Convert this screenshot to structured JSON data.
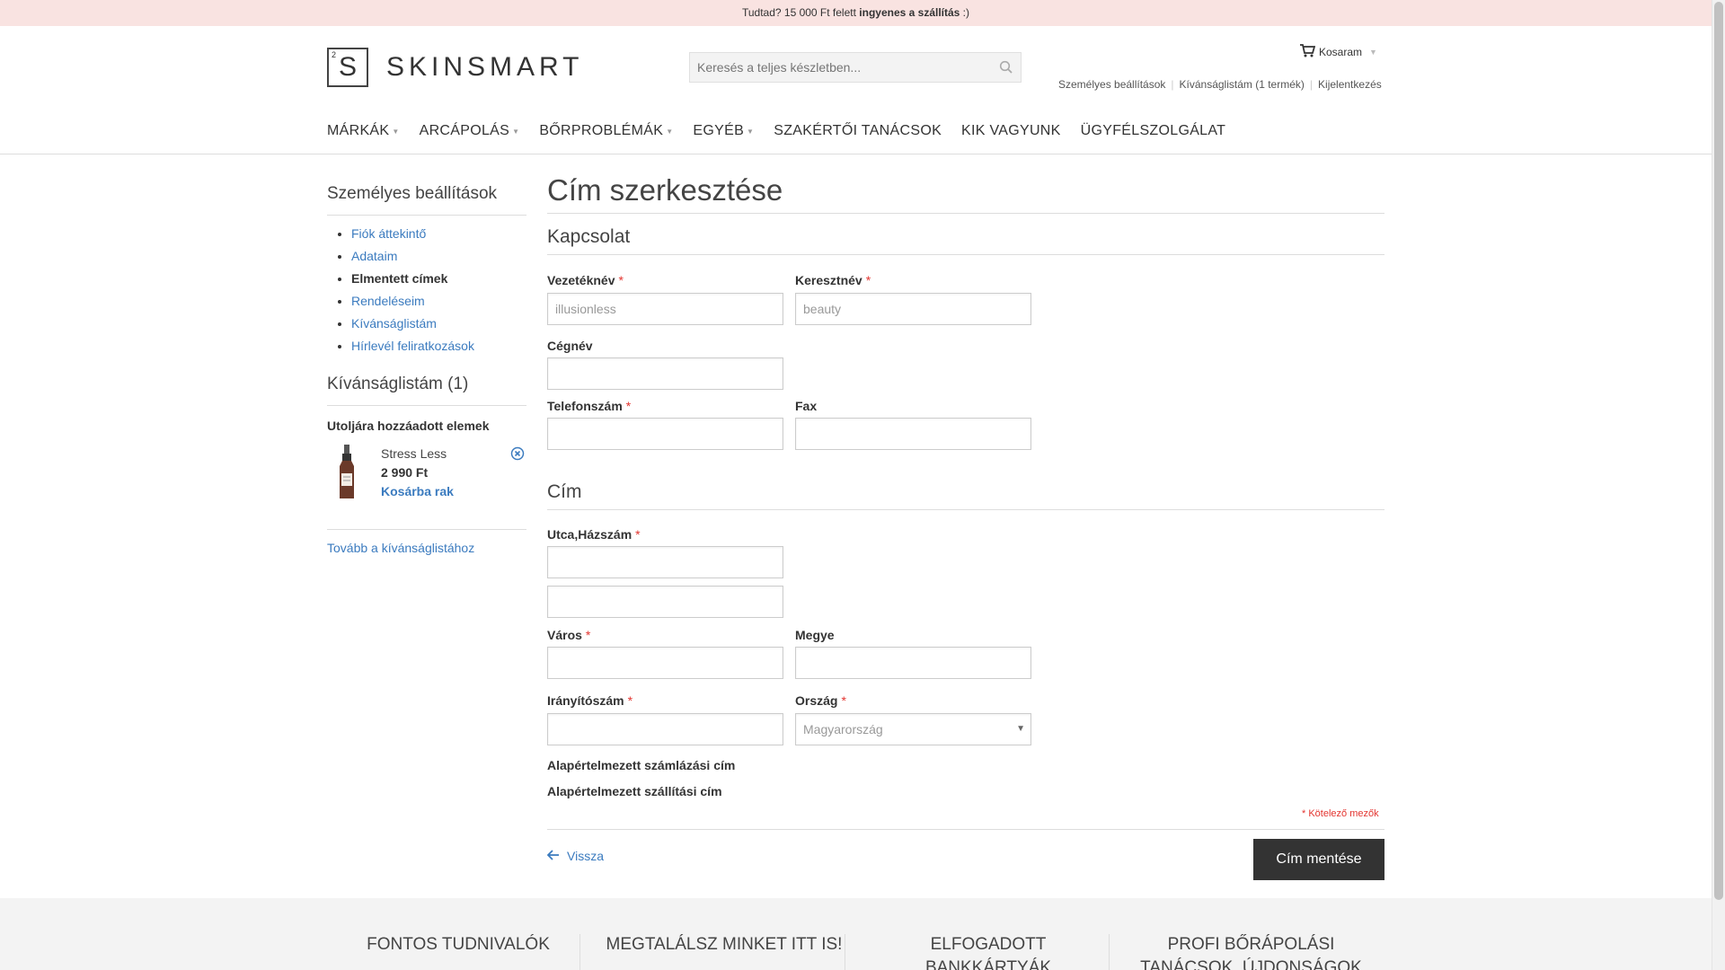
{
  "topbar": {
    "text_prefix": "Tudtad? 15 000 Ft felett ",
    "text_bold": "ingyenes a szállítás",
    "text_suffix": " :)"
  },
  "header": {
    "logo_superscript": "2",
    "logo_letter": "S",
    "logo_word": "SKINSMART",
    "search_placeholder": "Keresés a teljes készletben...",
    "cart_label": "Kosaram",
    "top_links": [
      "Személyes beállítások",
      "Kívánságlistám (1 termék)",
      "Kijelentkezés"
    ]
  },
  "nav": {
    "items": [
      {
        "label": "MÁRKÁK",
        "dropdown": true
      },
      {
        "label": "ARCÁPOLÁS",
        "dropdown": true
      },
      {
        "label": "BŐRPROBLÉMÁK",
        "dropdown": true
      },
      {
        "label": "EGYÉB",
        "dropdown": true
      },
      {
        "label": "SZAKÉRTŐI TANÁCSOK",
        "dropdown": false
      },
      {
        "label": "KIK VAGYUNK",
        "dropdown": false
      },
      {
        "label": "ÜGYFÉLSZOLGÁLAT",
        "dropdown": false
      }
    ]
  },
  "sidebar": {
    "title": "Személyes beállítások",
    "items": [
      {
        "label": "Fiók áttekintő",
        "active": false
      },
      {
        "label": "Adataim",
        "active": false
      },
      {
        "label": "Elmentett címek",
        "active": true
      },
      {
        "label": "Rendeléseim",
        "active": false
      },
      {
        "label": "Kívánságlistám",
        "active": false
      },
      {
        "label": "Hírlevél feliratkozások",
        "active": false
      }
    ],
    "wishlist_title": "Kívánságlistám (1)",
    "wishlist_subtitle": "Utoljára hozzáadott elemek",
    "wishlist_item": {
      "name": "Stress Less",
      "price": "2 990 Ft",
      "add_to_cart": "Kosárba rak"
    },
    "wishlist_more": "Tovább a kívánságlistához"
  },
  "form": {
    "page_title": "Cím szerkesztése",
    "contact_title": "Kapcsolat",
    "address_title": "Cím",
    "fields": {
      "lastname": {
        "label": "Vezetéknév",
        "value": "illusionless",
        "required": "*"
      },
      "firstname": {
        "label": "Keresztnév",
        "value": "beauty",
        "required": "*"
      },
      "company": {
        "label": "Cégnév",
        "value": ""
      },
      "phone": {
        "label": "Telefonszám",
        "value": "",
        "required": "*"
      },
      "fax": {
        "label": "Fax",
        "value": ""
      },
      "street": {
        "label": "Utca,Házszám",
        "value": "",
        "required": "*"
      },
      "street2": {
        "value": ""
      },
      "city": {
        "label": "Város",
        "value": "",
        "required": "*"
      },
      "region": {
        "label": "Megye",
        "value": ""
      },
      "zip": {
        "label": "Irányítószám",
        "value": "",
        "required": "*"
      },
      "country": {
        "label": "Ország",
        "value": "Magyarország",
        "required": "*"
      }
    },
    "default_billing": "Alapértelmezett számlázási cím",
    "default_shipping": "Alapértelmezett szállítási cím",
    "required_note": "* Kötelező mezők",
    "back_label": "Vissza",
    "save_label": "Cím mentése"
  },
  "footer": {
    "columns": [
      "FONTOS TUDNIVALÓK",
      "MEGTALÁLSZ MINKET ITT IS!",
      "ELFOGADOTT BANKKÁRTYÁK",
      "PROFI BŐRÁPOLÁSI TANÁCSOK, ÚJDONSÁGOK"
    ]
  },
  "colors": {
    "topbar_bg": "#f9e3e1",
    "link": "#3b7bbf",
    "required": "#e3342f",
    "button_bg": "#333333"
  }
}
